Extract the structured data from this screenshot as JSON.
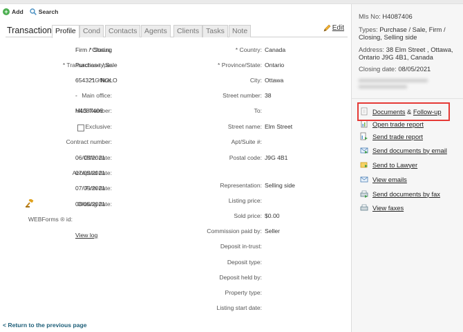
{
  "toolbar": {
    "add_label": "Add",
    "search_label": "Search"
  },
  "tabs": {
    "title": "Transaction",
    "items": [
      "Profile",
      "Cond",
      "Contacts",
      "Agents",
      "Clients",
      "Tasks",
      "Note"
    ],
    "active": "Profile",
    "edit_label": "Edit"
  },
  "profile": {
    "left_fields": [
      {
        "label": "* Status:",
        "value": "Firm / Closing"
      },
      {
        "label": "* Transaction type:",
        "value": "Purchase / Sale"
      },
      {
        "label": "* Office:",
        "value": "654321 - NOLO"
      },
      {
        "label": "Main office:",
        "value": "-"
      },
      {
        "label": "MLS Number:",
        "value": "H4087406"
      },
      {
        "label": "Exclusive:",
        "value": ""
      },
      {
        "label": "Contract number:",
        "value": ""
      },
      {
        "label": "Offer date:",
        "value": "06/05/2021"
      },
      {
        "label": "Accepted date:",
        "value": "07/05/2021"
      },
      {
        "label": "Firm date:",
        "value": "07/05/2021"
      },
      {
        "label": "Closing date:",
        "value": "08/05/2021"
      },
      {
        "label": "WEBForms ® id:",
        "value": ""
      }
    ],
    "right_fields": [
      {
        "label": "* Country:",
        "value": "Canada"
      },
      {
        "label": "* Province/State:",
        "value": "Ontario"
      },
      {
        "label": "City:",
        "value": "Ottawa"
      },
      {
        "label": "Street number:",
        "value": "38"
      },
      {
        "label": "To:",
        "value": ""
      },
      {
        "label": "Street name:",
        "value": "Elm Street"
      },
      {
        "label": "Apt/Suite #:",
        "value": ""
      },
      {
        "label": "Postal code:",
        "value": "J9G 4B1"
      },
      {
        "label": "Representation:",
        "value": "Selling side"
      },
      {
        "label": "Listing price:",
        "value": ""
      },
      {
        "label": "Sold price:",
        "value": "$0.00"
      },
      {
        "label": "Commission paid by:",
        "value": "Seller"
      },
      {
        "label": "Deposit in-trust:",
        "value": ""
      },
      {
        "label": "Deposit type:",
        "value": ""
      },
      {
        "label": "Deposit held by:",
        "value": ""
      },
      {
        "label": "Property type:",
        "value": ""
      },
      {
        "label": "Listing start date:",
        "value": ""
      }
    ],
    "view_log_label": "View log"
  },
  "return_link": "< Return to the previous page",
  "summary": {
    "mls_label": "Mls No:",
    "mls_value": "H4087406",
    "types_label": "Types:",
    "types_value": "Purchase / Sale, Firm / Closing, Selling side",
    "address_label": "Address:",
    "address_value": "38 Elm Street , Ottawa, Ontario J9G 4B1, Canada",
    "closing_label": "Closing date:",
    "closing_value": "08/05/2021"
  },
  "side_links": {
    "documents": "Documents",
    "amp": "&",
    "followup": "Follow-up",
    "open_trade_report": "Open trade report",
    "send_trade_report": "Send trade report",
    "send_docs_email": "Send documents by email",
    "send_to_lawyer": "Send to Lawyer",
    "view_emails": "View emails",
    "send_docs_fax": "Send documents by fax",
    "view_faxes": "View faxes"
  },
  "colors": {
    "highlight": "#e53935",
    "return_link": "#1b5d77",
    "add_icon": "#4caf50"
  }
}
